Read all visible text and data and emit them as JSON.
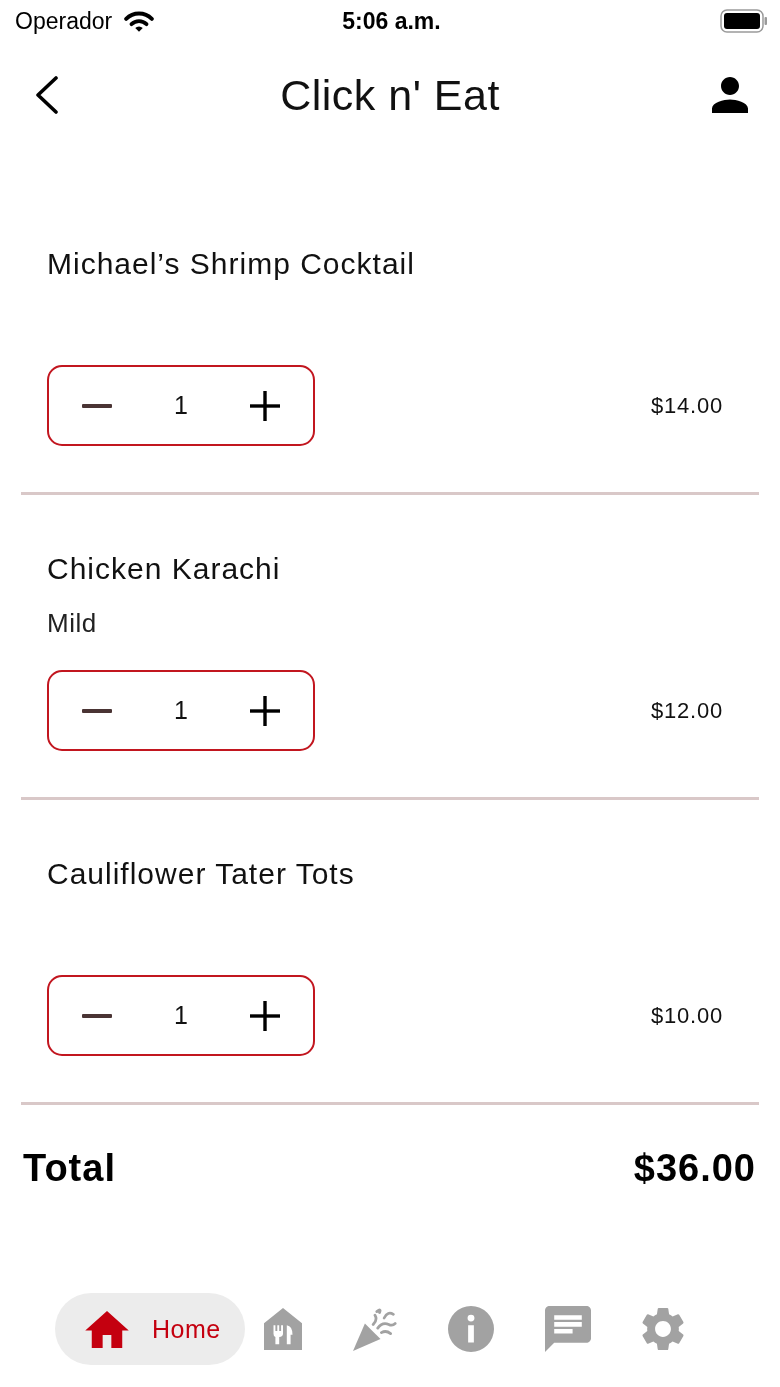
{
  "status_bar": {
    "carrier": "Operador",
    "time": "5:06 a.m."
  },
  "header": {
    "title": "Click n' Eat"
  },
  "cart_items": [
    {
      "name": "Michael’s Shrimp Cocktail",
      "quantity": "1",
      "price": "$14.00"
    },
    {
      "name": "Chicken Karachi",
      "option": "Mild",
      "quantity": "1",
      "price": "$12.00"
    },
    {
      "name": "Cauliflower Tater Tots",
      "quantity": "1",
      "price": "$10.00"
    }
  ],
  "total": {
    "label": "Total",
    "amount": "$36.00"
  },
  "bottom_nav": [
    {
      "kind": "home",
      "label": "Home",
      "selected": true
    },
    {
      "kind": "restaurant",
      "selected": false
    },
    {
      "kind": "party",
      "selected": false
    },
    {
      "kind": "info",
      "selected": false
    },
    {
      "kind": "chat",
      "selected": false
    },
    {
      "kind": "settings",
      "selected": false
    }
  ]
}
